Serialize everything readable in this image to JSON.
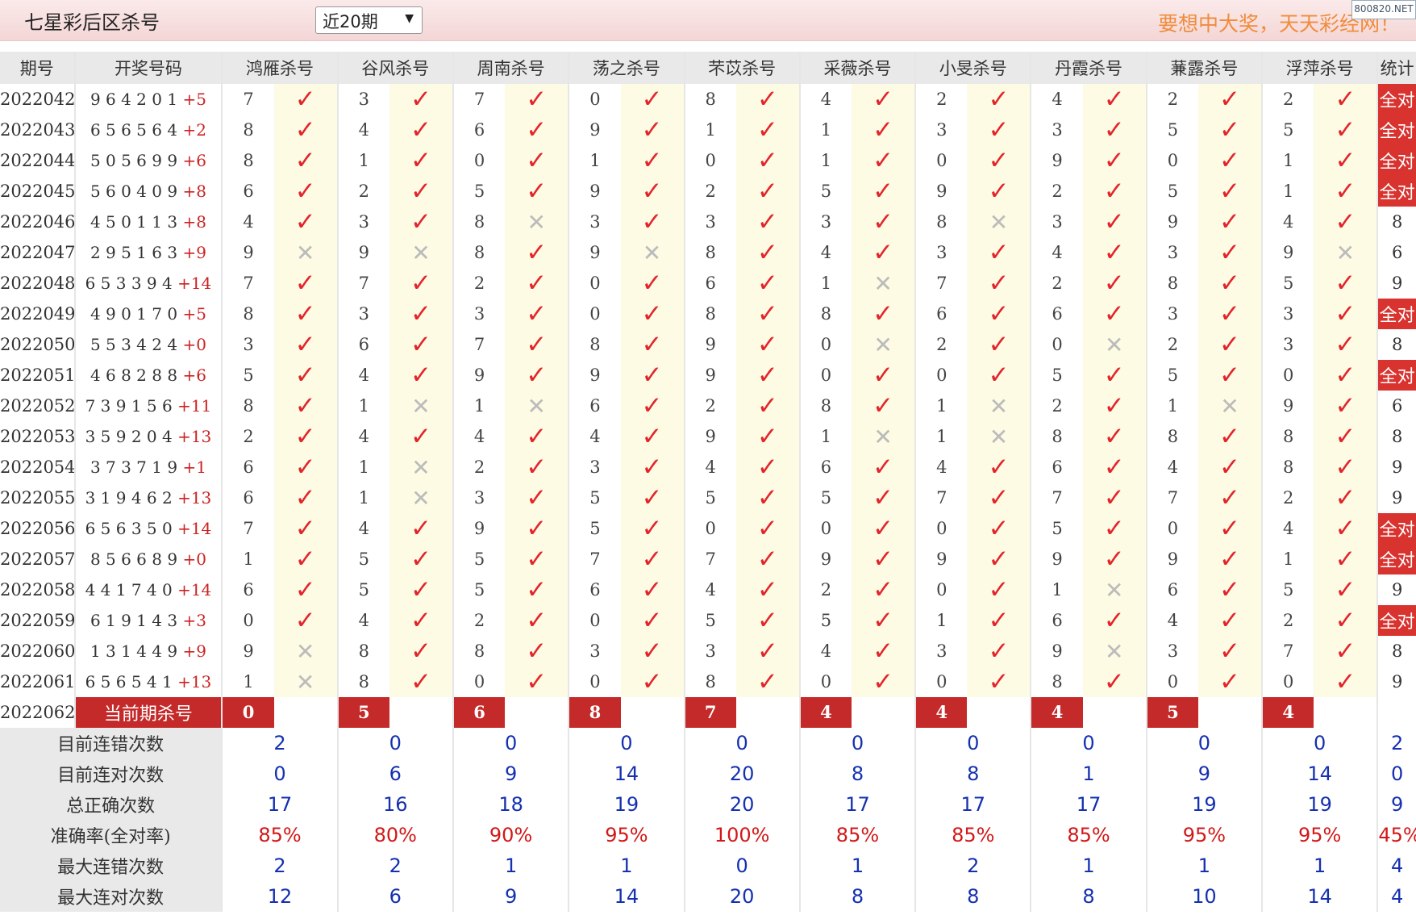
{
  "header": {
    "title": "七星彩后区杀号",
    "period_select": "近20期",
    "slogan": "要想中大奖，天天彩经网！",
    "watermark": "800820.NET"
  },
  "columns": {
    "issue": "期号",
    "draw": "开奖号码",
    "experts": [
      "鸿雁杀号",
      "谷风杀号",
      "周南杀号",
      "荡之杀号",
      "芣苡杀号",
      "采薇杀号",
      "小旻杀号",
      "丹霞杀号",
      "蒹露杀号",
      "浮萍杀号"
    ],
    "stat": "统计"
  },
  "rows": [
    {
      "issue": "2022042",
      "digits": "9 6 4 2 0 1",
      "back": "+5",
      "kills": [
        "7",
        "3",
        "7",
        "0",
        "8",
        "4",
        "2",
        "4",
        "2",
        "2"
      ],
      "hits": [
        1,
        1,
        1,
        1,
        1,
        1,
        1,
        1,
        1,
        1
      ],
      "stat": "全对"
    },
    {
      "issue": "2022043",
      "digits": "6 5 6 5 6 4",
      "back": "+2",
      "kills": [
        "8",
        "4",
        "6",
        "9",
        "1",
        "1",
        "3",
        "3",
        "5",
        "5"
      ],
      "hits": [
        1,
        1,
        1,
        1,
        1,
        1,
        1,
        1,
        1,
        1
      ],
      "stat": "全对"
    },
    {
      "issue": "2022044",
      "digits": "5 0 5 6 9 9",
      "back": "+6",
      "kills": [
        "8",
        "1",
        "0",
        "1",
        "0",
        "1",
        "0",
        "9",
        "0",
        "1"
      ],
      "hits": [
        1,
        1,
        1,
        1,
        1,
        1,
        1,
        1,
        1,
        1
      ],
      "stat": "全对"
    },
    {
      "issue": "2022045",
      "digits": "5 6 0 4 0 9",
      "back": "+8",
      "kills": [
        "6",
        "2",
        "5",
        "9",
        "2",
        "5",
        "9",
        "2",
        "5",
        "1"
      ],
      "hits": [
        1,
        1,
        1,
        1,
        1,
        1,
        1,
        1,
        1,
        1
      ],
      "stat": "全对"
    },
    {
      "issue": "2022046",
      "digits": "4 5 0 1 1 3",
      "back": "+8",
      "kills": [
        "4",
        "3",
        "8",
        "3",
        "3",
        "3",
        "8",
        "3",
        "9",
        "4"
      ],
      "hits": [
        1,
        1,
        0,
        1,
        1,
        1,
        0,
        1,
        1,
        1
      ],
      "stat": "8"
    },
    {
      "issue": "2022047",
      "digits": "2 9 5 1 6 3",
      "back": "+9",
      "kills": [
        "9",
        "9",
        "8",
        "9",
        "8",
        "4",
        "3",
        "4",
        "3",
        "9"
      ],
      "hits": [
        0,
        0,
        1,
        0,
        1,
        1,
        1,
        1,
        1,
        0
      ],
      "stat": "6"
    },
    {
      "issue": "2022048",
      "digits": "6 5 3 3 9 4",
      "back": "+14",
      "kills": [
        "7",
        "7",
        "2",
        "0",
        "6",
        "1",
        "7",
        "2",
        "8",
        "5"
      ],
      "hits": [
        1,
        1,
        1,
        1,
        1,
        0,
        1,
        1,
        1,
        1
      ],
      "stat": "9"
    },
    {
      "issue": "2022049",
      "digits": "4 9 0 1 7 0",
      "back": "+5",
      "kills": [
        "8",
        "3",
        "3",
        "0",
        "8",
        "8",
        "6",
        "6",
        "3",
        "3"
      ],
      "hits": [
        1,
        1,
        1,
        1,
        1,
        1,
        1,
        1,
        1,
        1
      ],
      "stat": "全对"
    },
    {
      "issue": "2022050",
      "digits": "5 5 3 4 2 4",
      "back": "+0",
      "kills": [
        "3",
        "6",
        "7",
        "8",
        "9",
        "0",
        "2",
        "0",
        "2",
        "3"
      ],
      "hits": [
        1,
        1,
        1,
        1,
        1,
        0,
        1,
        0,
        1,
        1
      ],
      "stat": "8"
    },
    {
      "issue": "2022051",
      "digits": "4 6 8 2 8 8",
      "back": "+6",
      "kills": [
        "5",
        "4",
        "9",
        "9",
        "9",
        "0",
        "0",
        "5",
        "5",
        "0"
      ],
      "hits": [
        1,
        1,
        1,
        1,
        1,
        1,
        1,
        1,
        1,
        1
      ],
      "stat": "全对"
    },
    {
      "issue": "2022052",
      "digits": "7 3 9 1 5 6",
      "back": "+11",
      "kills": [
        "8",
        "1",
        "1",
        "6",
        "2",
        "8",
        "1",
        "2",
        "1",
        "9"
      ],
      "hits": [
        1,
        0,
        0,
        1,
        1,
        1,
        0,
        1,
        0,
        1
      ],
      "stat": "6"
    },
    {
      "issue": "2022053",
      "digits": "3 5 9 2 0 4",
      "back": "+13",
      "kills": [
        "2",
        "4",
        "4",
        "4",
        "9",
        "1",
        "1",
        "8",
        "8",
        "8"
      ],
      "hits": [
        1,
        1,
        1,
        1,
        1,
        0,
        0,
        1,
        1,
        1
      ],
      "stat": "8"
    },
    {
      "issue": "2022054",
      "digits": "3 7 3 7 1 9",
      "back": "+1",
      "kills": [
        "6",
        "1",
        "2",
        "3",
        "4",
        "6",
        "4",
        "6",
        "4",
        "8"
      ],
      "hits": [
        1,
        0,
        1,
        1,
        1,
        1,
        1,
        1,
        1,
        1
      ],
      "stat": "9"
    },
    {
      "issue": "2022055",
      "digits": "3 1 9 4 6 2",
      "back": "+13",
      "kills": [
        "6",
        "1",
        "3",
        "5",
        "5",
        "5",
        "7",
        "7",
        "7",
        "2"
      ],
      "hits": [
        1,
        0,
        1,
        1,
        1,
        1,
        1,
        1,
        1,
        1
      ],
      "stat": "9"
    },
    {
      "issue": "2022056",
      "digits": "6 5 6 3 5 0",
      "back": "+14",
      "kills": [
        "7",
        "4",
        "9",
        "5",
        "0",
        "0",
        "0",
        "5",
        "0",
        "4"
      ],
      "hits": [
        1,
        1,
        1,
        1,
        1,
        1,
        1,
        1,
        1,
        1
      ],
      "stat": "全对"
    },
    {
      "issue": "2022057",
      "digits": "8 5 6 6 8 9",
      "back": "+0",
      "kills": [
        "1",
        "5",
        "5",
        "7",
        "7",
        "9",
        "9",
        "9",
        "9",
        "1"
      ],
      "hits": [
        1,
        1,
        1,
        1,
        1,
        1,
        1,
        1,
        1,
        1
      ],
      "stat": "全对"
    },
    {
      "issue": "2022058",
      "digits": "4 4 1 7 4 0",
      "back": "+14",
      "kills": [
        "6",
        "5",
        "5",
        "6",
        "4",
        "2",
        "0",
        "1",
        "6",
        "5"
      ],
      "hits": [
        1,
        1,
        1,
        1,
        1,
        1,
        1,
        0,
        1,
        1
      ],
      "stat": "9"
    },
    {
      "issue": "2022059",
      "digits": "6 1 9 1 4 3",
      "back": "+3",
      "kills": [
        "0",
        "4",
        "2",
        "0",
        "5",
        "5",
        "1",
        "6",
        "4",
        "2"
      ],
      "hits": [
        1,
        1,
        1,
        1,
        1,
        1,
        1,
        1,
        1,
        1
      ],
      "stat": "全对"
    },
    {
      "issue": "2022060",
      "digits": "1 3 1 4 4 9",
      "back": "+9",
      "kills": [
        "9",
        "8",
        "8",
        "3",
        "3",
        "4",
        "3",
        "9",
        "3",
        "7"
      ],
      "hits": [
        0,
        1,
        1,
        1,
        1,
        1,
        1,
        0,
        1,
        1
      ],
      "stat": "8"
    },
    {
      "issue": "2022061",
      "digits": "6 5 6 5 4 1",
      "back": "+13",
      "kills": [
        "1",
        "8",
        "0",
        "0",
        "8",
        "0",
        "0",
        "8",
        "0",
        "0"
      ],
      "hits": [
        0,
        1,
        1,
        1,
        1,
        1,
        1,
        1,
        1,
        1
      ],
      "stat": "9"
    }
  ],
  "current": {
    "issue": "2022062",
    "label": "当前期杀号",
    "kills": [
      "0",
      "5",
      "6",
      "8",
      "7",
      "4",
      "4",
      "4",
      "5",
      "4"
    ]
  },
  "stats": [
    {
      "label": "目前连错次数",
      "values": [
        "2",
        "0",
        "0",
        "0",
        "0",
        "0",
        "0",
        "0",
        "0",
        "0"
      ],
      "stat": "2"
    },
    {
      "label": "目前连对次数",
      "values": [
        "0",
        "6",
        "9",
        "14",
        "20",
        "8",
        "8",
        "1",
        "9",
        "14"
      ],
      "stat": "0"
    },
    {
      "label": "总正确次数",
      "values": [
        "17",
        "16",
        "18",
        "19",
        "20",
        "17",
        "17",
        "17",
        "19",
        "19"
      ],
      "stat": "9"
    },
    {
      "label": "准确率(全对率)",
      "values": [
        "85%",
        "80%",
        "90%",
        "95%",
        "100%",
        "85%",
        "85%",
        "85%",
        "95%",
        "95%"
      ],
      "stat": "45%",
      "pct": true
    },
    {
      "label": "最大连错次数",
      "values": [
        "2",
        "2",
        "1",
        "1",
        "0",
        "1",
        "2",
        "1",
        "1",
        "1"
      ],
      "stat": "4"
    },
    {
      "label": "最大连对次数",
      "values": [
        "12",
        "6",
        "9",
        "14",
        "20",
        "8",
        "8",
        "8",
        "10",
        "14"
      ],
      "stat": "4"
    }
  ],
  "glyphs": {
    "check": "✓",
    "cross": "✕"
  },
  "colors": {
    "check": "#e3242b",
    "cross": "#bbbbbb",
    "all_right_bg": "#d9332f",
    "current_bg": "#c52a2a",
    "stat_value": "#1530b0",
    "stat_pct": "#d21818",
    "mark_bg": "#fdfbe4",
    "header_bg": "#e9e9e9"
  }
}
